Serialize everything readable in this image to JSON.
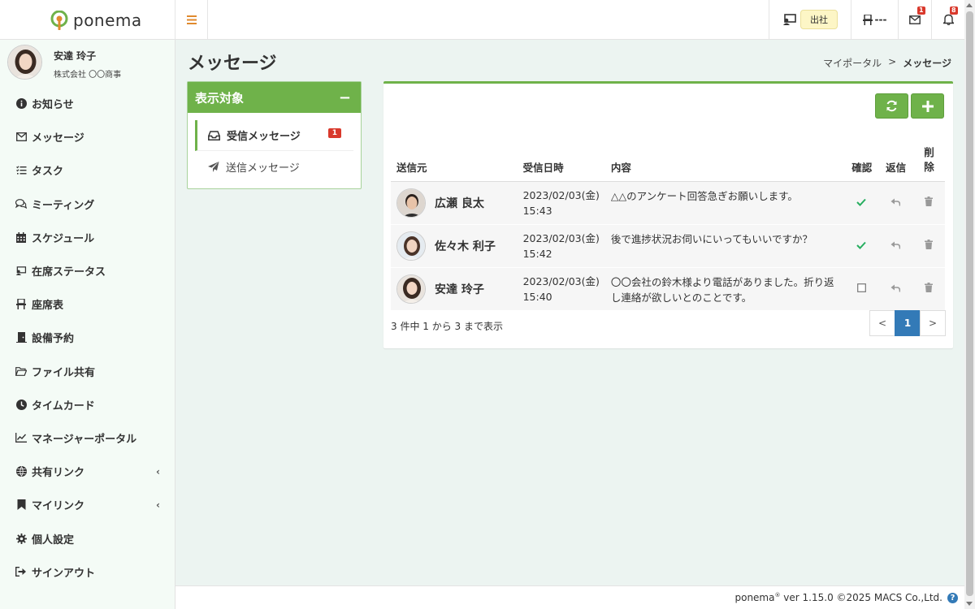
{
  "app": {
    "brand": "ponema",
    "attendance_status": "出社",
    "seat_status": "---",
    "mail_count": "1",
    "notification_count": "8"
  },
  "user": {
    "name": "安達 玲子",
    "company": "株式会社 〇〇商事"
  },
  "sidebar": {
    "items": [
      {
        "label": "お知らせ",
        "icon": "info-icon"
      },
      {
        "label": "メッセージ",
        "icon": "envelope-icon"
      },
      {
        "label": "タスク",
        "icon": "task-list-icon"
      },
      {
        "label": "ミーティング",
        "icon": "chat-icon"
      },
      {
        "label": "スケジュール",
        "icon": "calendar-icon"
      },
      {
        "label": "在席ステータス",
        "icon": "presence-icon"
      },
      {
        "label": "座席表",
        "icon": "seat-icon"
      },
      {
        "label": "設備予約",
        "icon": "door-icon"
      },
      {
        "label": "ファイル共有",
        "icon": "folder-icon"
      },
      {
        "label": "タイムカード",
        "icon": "clock-icon"
      },
      {
        "label": "マネージャーポータル",
        "icon": "chart-icon"
      },
      {
        "label": "共有リンク",
        "icon": "globe-icon"
      },
      {
        "label": "マイリンク",
        "icon": "bookmark-icon"
      },
      {
        "label": "個人設定",
        "icon": "gear-icon"
      },
      {
        "label": "サインアウト",
        "icon": "signout-icon"
      }
    ]
  },
  "page": {
    "title": "メッセージ",
    "breadcrumb_home": "マイポータル",
    "breadcrumb_sep": ">",
    "breadcrumb_current": "メッセージ"
  },
  "filter": {
    "title": "表示対象",
    "collapse": "−",
    "inbox_label": "受信メッセージ",
    "inbox_badge": "1",
    "sent_label": "送信メッセージ"
  },
  "table": {
    "headers": {
      "sender": "送信元",
      "received": "受信日時",
      "content": "内容",
      "confirm": "確認",
      "reply": "返信",
      "delete_line1": "削",
      "delete_line2": "除"
    },
    "rows": [
      {
        "sender": "広瀬 良太",
        "date": "2023/02/03(金)",
        "time": "15:43",
        "content": "△△のアンケート回答急ぎお願いします。",
        "confirmed": true
      },
      {
        "sender": "佐々木 利子",
        "date": "2023/02/03(金)",
        "time": "15:42",
        "content": "後で進捗状況お伺いにいってもいいですか？",
        "confirmed": true
      },
      {
        "sender": "安達 玲子",
        "date": "2023/02/03(金)",
        "time": "15:40",
        "content": "〇〇会社の鈴木様より電話がありました。折り返し連絡が欲しいとのことです。",
        "confirmed": false
      }
    ],
    "info": "3 件中 1 から 3 まで表示",
    "pager_prev": "<",
    "pager_current": "1",
    "pager_next": ">"
  },
  "footer": {
    "brand": "ponema",
    "reg": "®",
    "version": " ver 1.15.0 ©2025 MACS Co.,Ltd.",
    "help": "?"
  },
  "colors": {
    "accent_green": "#6fb24a",
    "badge_red": "#d9392c",
    "pager_blue": "#337ab7",
    "check_green": "#27ae60"
  }
}
